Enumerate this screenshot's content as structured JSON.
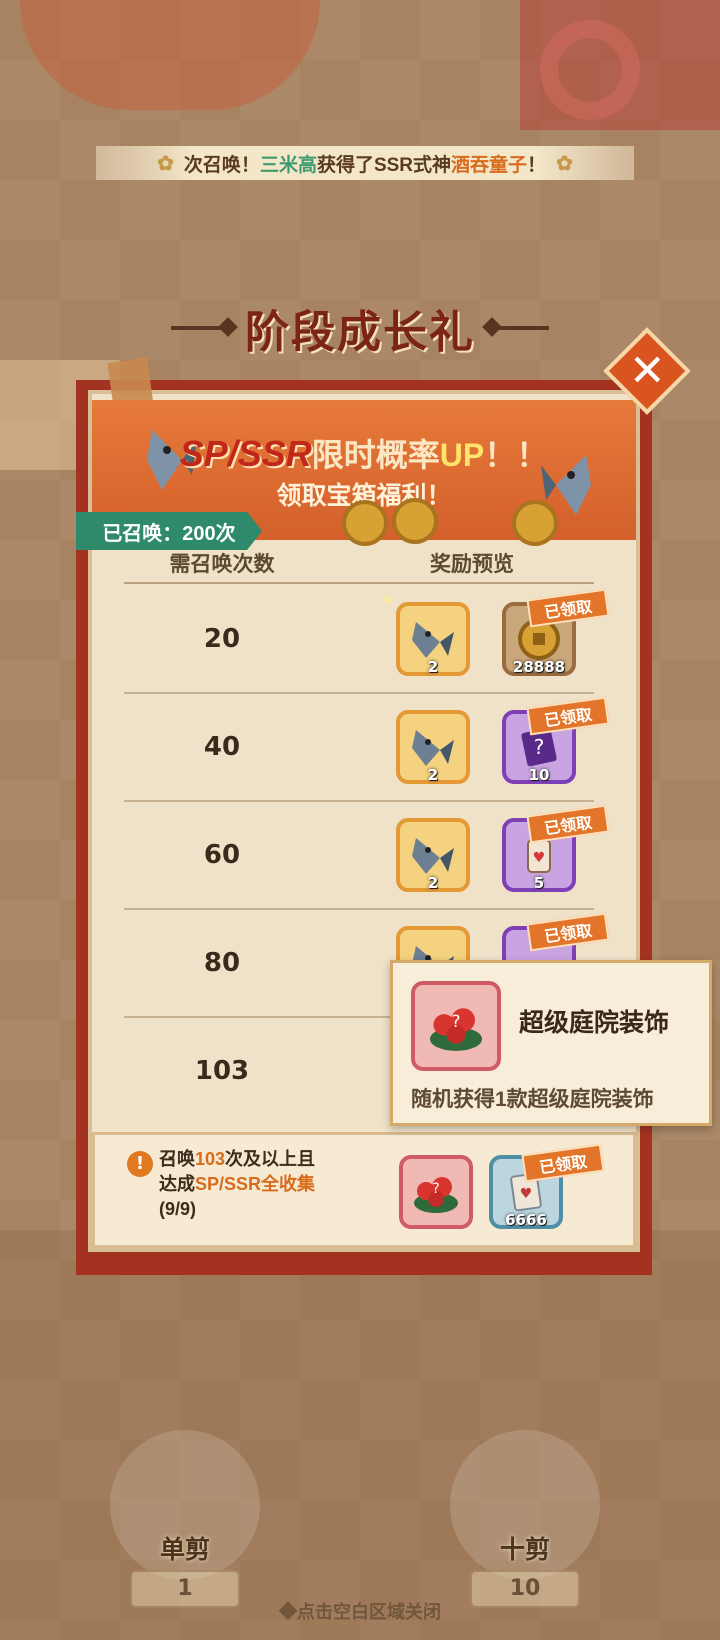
{
  "marquee": {
    "prefix": "次召唤！",
    "player": "三米高",
    "middle": "获得了SSR式神",
    "shikigami": "酒吞童子",
    "suffix": "！"
  },
  "title": "阶段成长礼",
  "banner": {
    "spssr": "SP/SSR",
    "rate_text": "限时概率",
    "up": "UP",
    "exclaim": "！！",
    "line2": "领取宝箱福利！"
  },
  "summoned_badge": "已召唤：200次",
  "table": {
    "col_required": "需召唤次数",
    "col_rewards": "奖励预览",
    "claimed_label": "已领取",
    "rows": [
      {
        "count": "20",
        "reward1_qty": "2",
        "reward2_qty": "28888",
        "reward2_icon": "coin-icon"
      },
      {
        "count": "40",
        "reward1_qty": "2",
        "reward2_qty": "10",
        "reward2_icon": "mystery-card-icon"
      },
      {
        "count": "60",
        "reward1_qty": "2",
        "reward2_qty": "5",
        "reward2_icon": "charm-bottle-icon"
      },
      {
        "count": "80",
        "reward1_qty": "2",
        "reward2_qty": "",
        "reward2_icon": "mystery-card-icon"
      },
      {
        "count": "103"
      }
    ]
  },
  "special": {
    "line1_prefix": "召唤",
    "line1_count": "103",
    "line1_suffix": "次及以上且",
    "line2_prefix": "达成",
    "line2_hl": "SP/SSR全收集",
    "progress": "(9/9)",
    "reward2_qty": "6666"
  },
  "tooltip": {
    "name": "超级庭院装饰",
    "desc": "随机获得1款超级庭院装饰"
  },
  "buttons": {
    "single_label": "单剪",
    "single_count": "1",
    "ten_label": "十剪",
    "ten_count": "10"
  },
  "close_hint": "◆点击空白区域关闭",
  "colors": {
    "accent_orange": "#e3752b",
    "badge_green": "#2f8a6b",
    "title_red": "#7d2515"
  }
}
